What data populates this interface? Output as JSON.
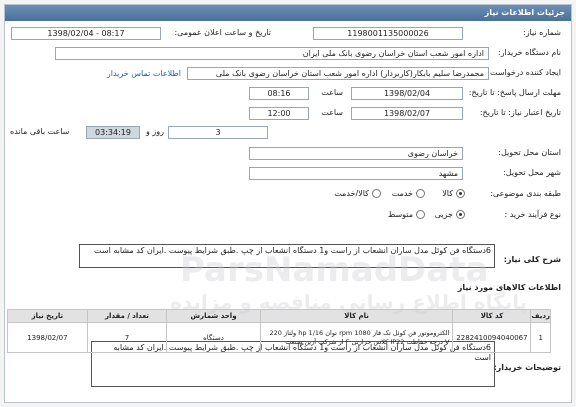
{
  "header": {
    "title": "جزئیات اطلاعات نیاز"
  },
  "fields": {
    "need_number_label": "شماره نیاز:",
    "need_number": "1198001135000026",
    "announce_date_label": "تاریخ و ساعت اعلان عمومی:",
    "announce_datetime": "1398/02/04 - 08:17",
    "buyer_label": "نام دستگاه خریدار:",
    "buyer": "اداره امور شعب استان خراسان رضوی بانک ملی ایران",
    "creator_label": "ایجاد کننده درخواست:",
    "creator": "محمدرضا سلیم  بابکار(کاربردار) اداره امور شعب استان خراسان رضوی بانک ملی",
    "contact_link": "اطلاعات تماس خریدار",
    "reply_deadline_label": "مهلت ارسال پاسخ: تا تاریخ:",
    "reply_date": "1398/02/04",
    "time_label": "ساعت",
    "reply_time": "08:16",
    "validity_label": "تاریخ اعتبار نیاز: تا تاریخ:",
    "validity_date": "1398/02/07",
    "validity_time": "12:00",
    "days_value": "3",
    "days_label": "روز و",
    "timer": "03:34:19",
    "remaining_label": "ساعت باقی مانده",
    "province_label": "استان محل تحویل:",
    "province": "خراسان رضوی",
    "city_label": "شهر محل تحویل:",
    "city": "مشهد",
    "category_label": "طبقه بندی موضوعی:",
    "category_options": [
      "کالا",
      "خدمت",
      "کالا/خدمت"
    ],
    "process_label": "نوع فرآیند خرید :",
    "process_options": [
      "جزیی",
      "متوسط"
    ]
  },
  "need_summary": {
    "label": "شرح کلی نیاز:",
    "text": "6دستگاه فن کوئل مدل ساران انشعاب از راست و1 دستگاه انشعاب از چپ .طبق شرایط پیوست .ایران کد مشابه است"
  },
  "items_section": {
    "title": "اطلاعات کالاهای مورد نیاز"
  },
  "table": {
    "headers": [
      "ردیف",
      "کد کالا",
      "نام کالا",
      "واحد شمارش",
      "تعداد / مقدار",
      "تاریخ نیاز"
    ],
    "rows": [
      {
        "index": "1",
        "code": "2282410094040067",
        "name": "الکتروموتور فن کوئل تک فاز rpm 1080 توان hp 1/16 ولتاژ 220 V درجه حفاظت IP22 کلاس حرارتی F از شرکت آرین صنعت",
        "unit": "دستگاه",
        "qty": "7",
        "date": "1398/02/07"
      }
    ]
  },
  "buyer_notes": {
    "label": "توضیحات خریدار:",
    "text": "6دستگاه فن کوئل مدل ساران انشعاب از راست و1 دستگاه انشعاب از چپ .طبق شرایط پیوست .ایران کد مشابه است"
  },
  "watermark": {
    "logo_text": "ParsNamadData",
    "tagline": "پایگاه اطلاع رسانی مناقصه و مزایده"
  }
}
